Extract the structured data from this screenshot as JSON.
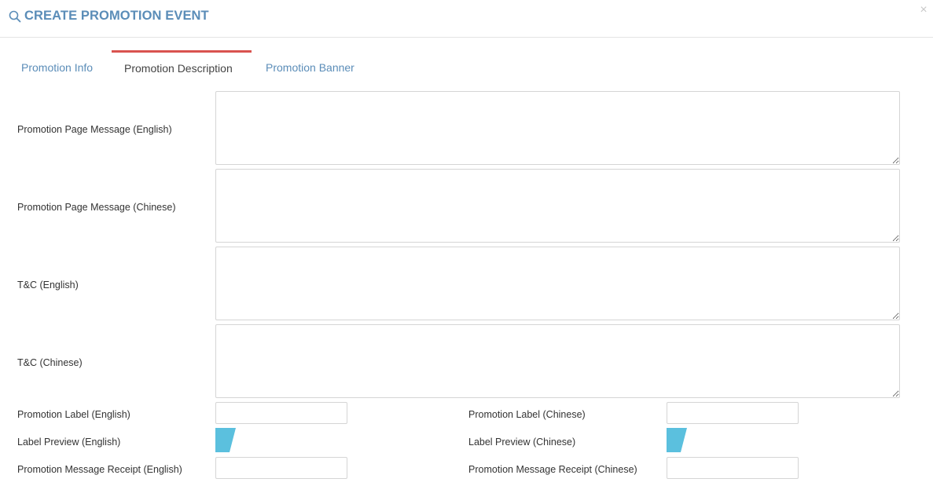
{
  "dialog": {
    "title": "CREATE PROMOTION EVENT",
    "title_icon": "search-icon",
    "close_label": "×"
  },
  "tabs": [
    {
      "label": "Promotion Info",
      "active": false
    },
    {
      "label": "Promotion Description",
      "active": true
    },
    {
      "label": "Promotion Banner",
      "active": false
    }
  ],
  "form": {
    "page_message_en": {
      "label": "Promotion Page Message (English)",
      "value": ""
    },
    "page_message_zh": {
      "label": "Promotion Page Message (Chinese)",
      "value": ""
    },
    "tc_en": {
      "label": "T&C (English)",
      "value": ""
    },
    "tc_zh": {
      "label": "T&C (Chinese)",
      "value": ""
    },
    "label_en": {
      "label": "Promotion Label (English)",
      "value": ""
    },
    "label_zh": {
      "label": "Promotion Label (Chinese)",
      "value": ""
    },
    "preview_en": {
      "label": "Label Preview (English)"
    },
    "preview_zh": {
      "label": "Label Preview (Chinese)"
    },
    "receipt_en": {
      "label": "Promotion Message Receipt (English)",
      "value": ""
    },
    "receipt_zh": {
      "label": "Promotion Message Receipt (Chinese)",
      "value": ""
    }
  },
  "colors": {
    "accent": "#5b8db8",
    "active_tab_border": "#d9534f",
    "label_preview": "#5bc0de"
  }
}
